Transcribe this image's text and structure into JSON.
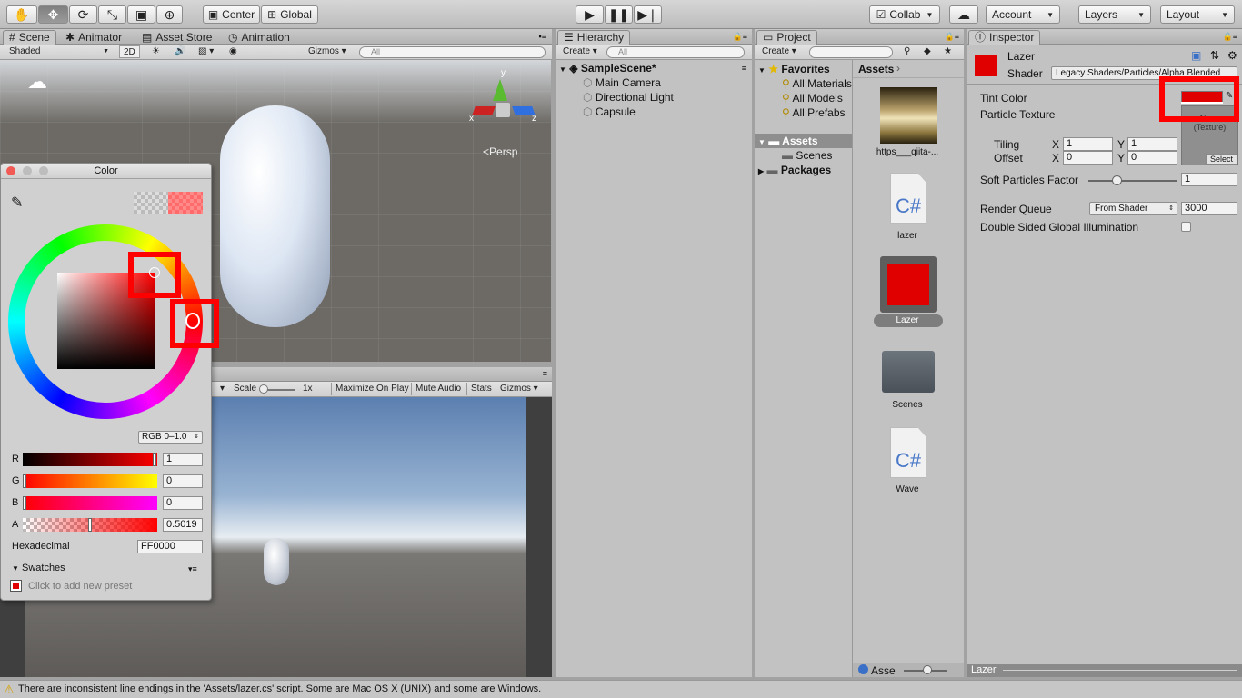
{
  "toolbar": {
    "center_label": "Center",
    "global_label": "Global",
    "collab_label": "Collab",
    "account_label": "Account",
    "layers_label": "Layers",
    "layout_label": "Layout"
  },
  "scene": {
    "tabs": [
      "Scene",
      "Animator",
      "Asset Store",
      "Animation"
    ],
    "shading": "Shaded",
    "mode2d": "2D",
    "gizmos": "Gizmos",
    "search_placeholder": "All",
    "persp": "Persp",
    "axes": {
      "x": "x",
      "y": "y",
      "z": "z"
    }
  },
  "game": {
    "scale_label": "Scale",
    "scale_value": "1x",
    "maximize": "Maximize On Play",
    "mute": "Mute Audio",
    "stats": "Stats",
    "gizmos": "Gizmos"
  },
  "color_picker": {
    "title": "Color",
    "mode": "RGB 0–1.0",
    "channels": [
      {
        "label": "R",
        "value": "1"
      },
      {
        "label": "G",
        "value": "0"
      },
      {
        "label": "B",
        "value": "0"
      },
      {
        "label": "A",
        "value": "0.5019"
      }
    ],
    "alpha_fraction": 0.5019,
    "hex_label": "Hexadecimal",
    "hex_value": "FF0000",
    "swatches_label": "Swatches",
    "swatches_hint": "Click to add new preset"
  },
  "hierarchy": {
    "tab": "Hierarchy",
    "create": "Create",
    "search_placeholder": "All",
    "scene": "SampleScene*",
    "items": [
      "Main Camera",
      "Directional Light",
      "Capsule"
    ]
  },
  "project": {
    "tab": "Project",
    "create": "Create",
    "favorites_label": "Favorites",
    "favorites": [
      "All Materials",
      "All Models",
      "All Prefabs"
    ],
    "tree": [
      {
        "label": "Assets"
      },
      {
        "label": "Scenes"
      },
      {
        "label": "Packages"
      }
    ],
    "breadcrumb": "Assets",
    "assets": [
      {
        "name": "https___qiita-...",
        "kind": "texture"
      },
      {
        "name": "lazer",
        "kind": "script"
      },
      {
        "name": "Lazer",
        "kind": "material"
      },
      {
        "name": "Scenes",
        "kind": "folder"
      },
      {
        "name": "Wave",
        "kind": "script"
      }
    ],
    "footer_label": "Asse",
    "cs_label": "C#"
  },
  "inspector": {
    "tab": "Inspector",
    "material_name": "Lazer",
    "shader_label": "Shader",
    "shader_value": "Legacy Shaders/Particles/Alpha Blended",
    "tint_label": "Tint Color",
    "texture_label": "Particle Texture",
    "texture_none": "None",
    "texture_kind": "(Texture)",
    "select_label": "Select",
    "tiling_label": "Tiling",
    "offset_label": "Offset",
    "x_label": "X",
    "y_label": "Y",
    "tiling_x": "1",
    "tiling_y": "1",
    "offset_x": "0",
    "offset_y": "0",
    "soft_label": "Soft Particles Factor",
    "soft_value": "1",
    "queue_label": "Render Queue",
    "queue_mode": "From Shader",
    "queue_value": "3000",
    "gi_label": "Double Sided Global Illumination",
    "footer_label": "Lazer"
  },
  "status": {
    "message": "There are inconsistent line endings in the 'Assets/lazer.cs' script. Some are Mac OS X (UNIX) and some are Windows."
  },
  "colors": {
    "accent_red": "#e00000",
    "selected_blue": "#8a8a8a"
  }
}
